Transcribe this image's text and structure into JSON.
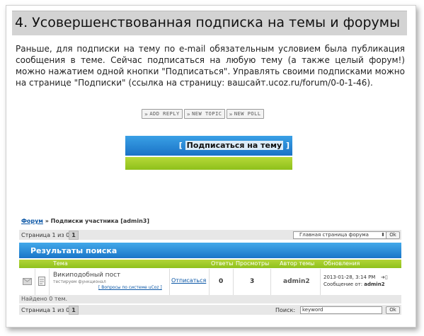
{
  "heading": "4. Усовершенствованная подписка на темы и форумы",
  "paragraph": "Раньше, для подписки на тему по e-mail обязательным условием была публикация сообщения в теме. Сейчас подписаться на любую тему (а также целый форум!) можно нажатием одной кнопки \"Подписаться\". Управлять своими подписками можно на странице \"Подписки\" (ссылка на страницу: вашсайт.ucoz.ru/forum/0-0-1-46).",
  "demo1": {
    "buttons": [
      "ADD REPLY",
      "NEW TOPIC",
      "NEW POLL"
    ],
    "subscribe_open": "[ ",
    "subscribe_label": "Подписаться на тему",
    "subscribe_close": " ]"
  },
  "demo2": {
    "breadcrumb_link": "Форум",
    "breadcrumb_rest": " » Подписки участника [admin3]",
    "pager_text": "Страница 1 из 0",
    "page_num": "1",
    "select_value": "Главная страница форума",
    "ok_label": "Ok",
    "results_title": "Результаты поиска",
    "columns": [
      "Тема",
      "Ответы",
      "Просмотры",
      "Автор темы",
      "Обновления"
    ],
    "row": {
      "topic_title": "Википодобный пост",
      "topic_desc": "тестируем функционал",
      "topic_forum": "[ Вопросы по системе uCoz ]",
      "unsubscribe": "Отписаться",
      "replies": "0",
      "views": "3",
      "author": "admin2",
      "update_date": "2013-01-28, 3:14 PM",
      "update_by_label": "Сообщение от: ",
      "update_by": "admin2"
    },
    "found_text": "Найдено 0 тем.",
    "search_label": "Поиск:",
    "search_value": "keyword"
  }
}
